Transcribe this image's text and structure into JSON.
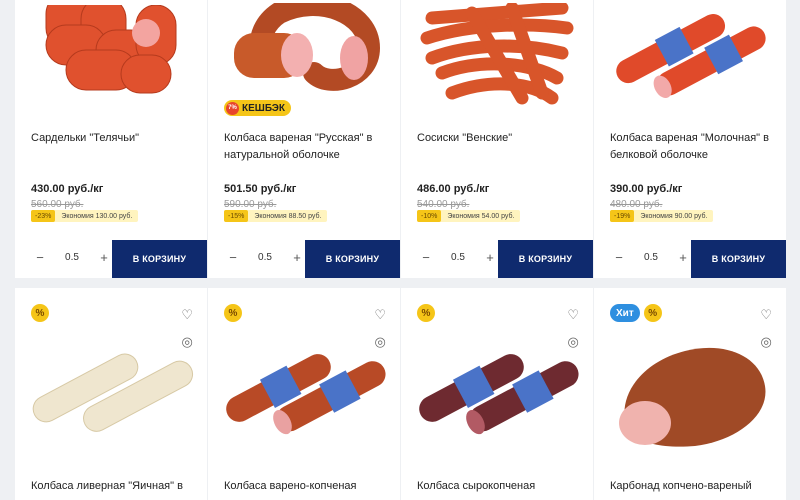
{
  "products": [
    {
      "name": "Сардельки \"Телячьи\"",
      "price": "430.00 руб./кг",
      "old_price": "560.00 руб.",
      "econ_tag": "-23%",
      "econ_text": "Экономия 130.00 руб.",
      "qty": "0.5",
      "cart_label": "В КОРЗИНУ",
      "image": "sausages-bunch"
    },
    {
      "name": "Колбаса вареная \"Русская\" в натуральной оболочке",
      "price": "501.50 руб./кг",
      "old_price": "590.00 руб.",
      "econ_tag": "-15%",
      "econ_text": "Экономия 88.50 руб.",
      "qty": "0.5",
      "cart_label": "В КОРЗИНУ",
      "cashback": "КЕШБЭК",
      "cashback_icon": "7%",
      "image": "sausage-ring"
    },
    {
      "name": "Сосиски \"Венские\"",
      "price": "486.00 руб./кг",
      "old_price": "540.00 руб.",
      "econ_tag": "-10%",
      "econ_text": "Экономия 54.00 руб.",
      "qty": "0.5",
      "cart_label": "В КОРЗИНУ",
      "image": "wieners-pile"
    },
    {
      "name": "Колбаса вареная \"Молочная\" в белковой оболочке",
      "price": "390.00 руб./кг",
      "old_price": "480.00 руб.",
      "econ_tag": "-19%",
      "econ_text": "Экономия 90.00 руб.",
      "qty": "0.5",
      "cart_label": "В КОРЗИНУ",
      "image": "boiled-sausage-sticks"
    },
    {
      "name": "Колбаса ливерная \"Яичная\" в",
      "pct_badge": "%",
      "image": "liver-sausage"
    },
    {
      "name": "Колбаса варено-копченая",
      "pct_badge": "%",
      "image": "smoked-sausage"
    },
    {
      "name": "Колбаса сырокопченая",
      "pct_badge": "%",
      "image": "dry-cured-sausage"
    },
    {
      "name": "Карбонад копчено-вареный",
      "pct_badge": "%",
      "hit_badge": "Хит",
      "image": "carbonade"
    }
  ],
  "icons": {
    "favorite": "heart-icon",
    "compare": "compare-icon",
    "minus": "minus-icon",
    "plus": "plus-icon"
  }
}
